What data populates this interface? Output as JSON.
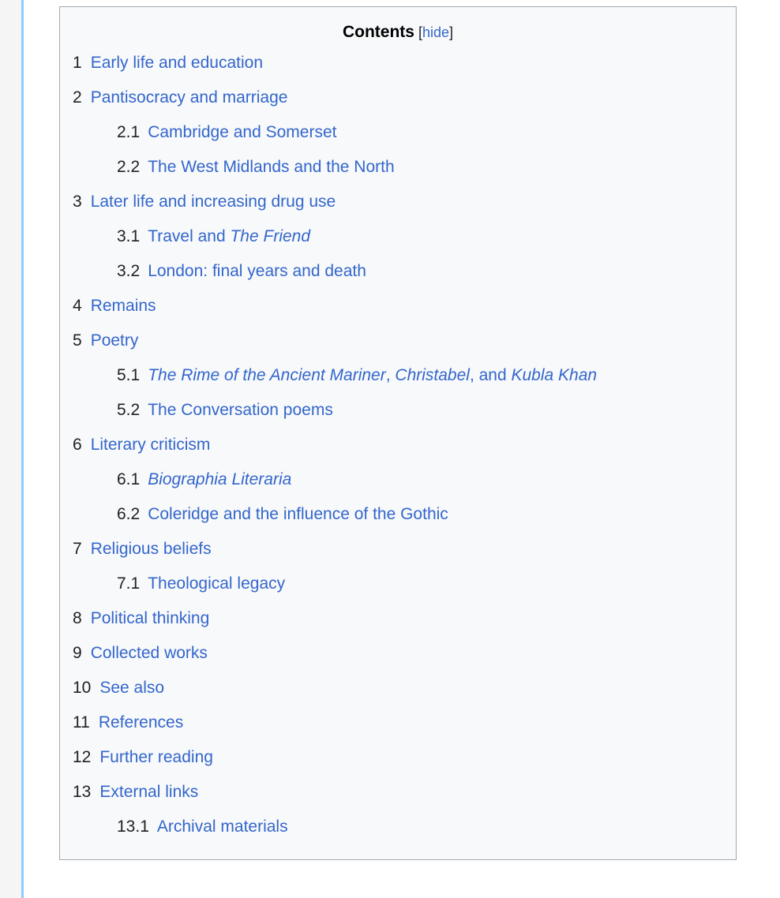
{
  "toc": {
    "title": "Contents",
    "toggle": {
      "open_bracket": "[",
      "label": "hide",
      "close_bracket": "]"
    },
    "colors": {
      "link": "#3366cc",
      "text": "#202122",
      "box_background": "#f8f9fa",
      "box_border": "#a2a9b1",
      "gutter": "#f5f5f5",
      "gutter_rule": "#8ecbfa"
    },
    "entries": [
      {
        "number": "1",
        "level": 1,
        "text": "Early life and education",
        "parts": [
          {
            "t": "Early life and education",
            "i": false
          }
        ]
      },
      {
        "number": "2",
        "level": 1,
        "text": "Pantisocracy and marriage",
        "parts": [
          {
            "t": "Pantisocracy and marriage",
            "i": false
          }
        ]
      },
      {
        "number": "2.1",
        "level": 2,
        "text": "Cambridge and Somerset",
        "parts": [
          {
            "t": "Cambridge and Somerset",
            "i": false
          }
        ]
      },
      {
        "number": "2.2",
        "level": 2,
        "text": "The West Midlands and the North",
        "parts": [
          {
            "t": "The West Midlands and the North",
            "i": false
          }
        ]
      },
      {
        "number": "3",
        "level": 1,
        "text": "Later life and increasing drug use",
        "parts": [
          {
            "t": "Later life and increasing drug use",
            "i": false
          }
        ]
      },
      {
        "number": "3.1",
        "level": 2,
        "text": "Travel and The Friend",
        "parts": [
          {
            "t": "Travel and ",
            "i": false
          },
          {
            "t": "The Friend",
            "i": true
          }
        ]
      },
      {
        "number": "3.2",
        "level": 2,
        "text": "London: final years and death",
        "parts": [
          {
            "t": "London: final years and death",
            "i": false
          }
        ]
      },
      {
        "number": "4",
        "level": 1,
        "text": "Remains",
        "parts": [
          {
            "t": "Remains",
            "i": false
          }
        ]
      },
      {
        "number": "5",
        "level": 1,
        "text": "Poetry",
        "parts": [
          {
            "t": "Poetry",
            "i": false
          }
        ]
      },
      {
        "number": "5.1",
        "level": 2,
        "text": "The Rime of the Ancient Mariner, Christabel, and Kubla Khan",
        "parts": [
          {
            "t": "The Rime of the Ancient Mariner",
            "i": true
          },
          {
            "t": ", ",
            "i": false
          },
          {
            "t": "Christabel",
            "i": true
          },
          {
            "t": ", and ",
            "i": false
          },
          {
            "t": "Kubla Khan",
            "i": true
          }
        ]
      },
      {
        "number": "5.2",
        "level": 2,
        "text": "The Conversation poems",
        "parts": [
          {
            "t": "The Conversation poems",
            "i": false
          }
        ]
      },
      {
        "number": "6",
        "level": 1,
        "text": "Literary criticism",
        "parts": [
          {
            "t": "Literary criticism",
            "i": false
          }
        ]
      },
      {
        "number": "6.1",
        "level": 2,
        "text": "Biographia Literaria",
        "parts": [
          {
            "t": "Biographia Literaria",
            "i": true
          }
        ]
      },
      {
        "number": "6.2",
        "level": 2,
        "text": "Coleridge and the influence of the Gothic",
        "parts": [
          {
            "t": "Coleridge and the influence of the Gothic",
            "i": false
          }
        ]
      },
      {
        "number": "7",
        "level": 1,
        "text": "Religious beliefs",
        "parts": [
          {
            "t": "Religious beliefs",
            "i": false
          }
        ]
      },
      {
        "number": "7.1",
        "level": 2,
        "text": "Theological legacy",
        "parts": [
          {
            "t": "Theological legacy",
            "i": false
          }
        ]
      },
      {
        "number": "8",
        "level": 1,
        "text": "Political thinking",
        "parts": [
          {
            "t": "Political thinking",
            "i": false
          }
        ]
      },
      {
        "number": "9",
        "level": 1,
        "text": "Collected works",
        "parts": [
          {
            "t": "Collected works",
            "i": false
          }
        ]
      },
      {
        "number": "10",
        "level": 1,
        "text": "See also",
        "parts": [
          {
            "t": "See also",
            "i": false
          }
        ]
      },
      {
        "number": "11",
        "level": 1,
        "text": "References",
        "parts": [
          {
            "t": "References",
            "i": false
          }
        ]
      },
      {
        "number": "12",
        "level": 1,
        "text": "Further reading",
        "parts": [
          {
            "t": "Further reading",
            "i": false
          }
        ]
      },
      {
        "number": "13",
        "level": 1,
        "text": "External links",
        "parts": [
          {
            "t": "External links",
            "i": false
          }
        ]
      },
      {
        "number": "13.1",
        "level": 2,
        "text": "Archival materials",
        "parts": [
          {
            "t": "Archival materials",
            "i": false
          }
        ]
      }
    ]
  }
}
